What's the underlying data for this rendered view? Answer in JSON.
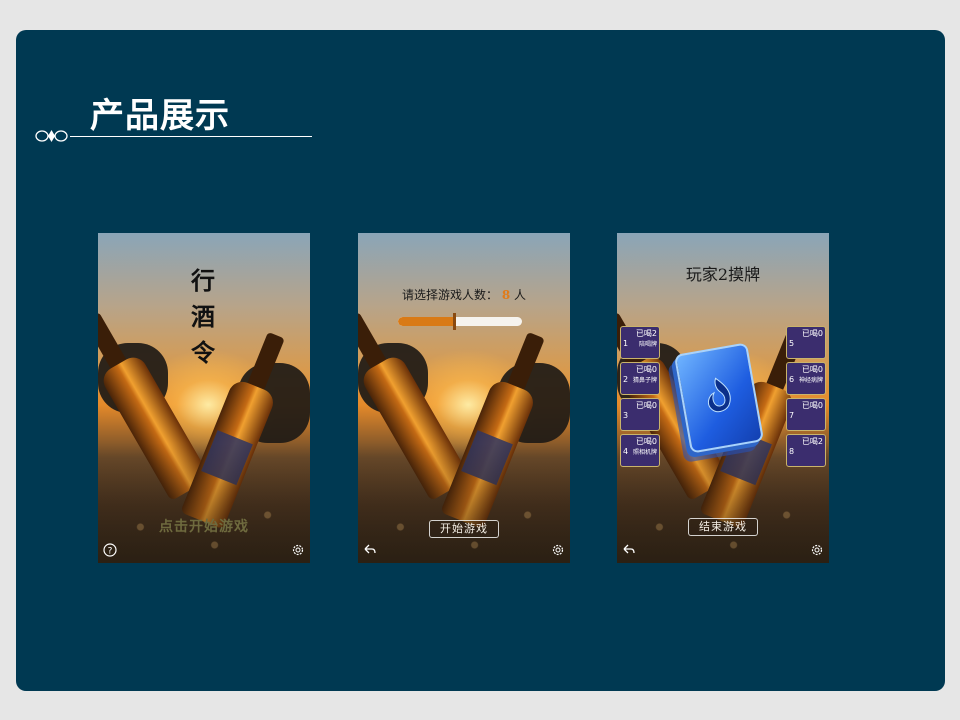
{
  "slide": {
    "title": "产品展示",
    "colors": {
      "background": "#003952",
      "accent": "#e07b1a",
      "text": "#ffffff"
    }
  },
  "screen1": {
    "title_chars": [
      "行",
      "酒",
      "令"
    ],
    "start_hint": "点击开始游戏",
    "icons": [
      "help-icon",
      "gear-icon"
    ]
  },
  "screen2": {
    "prompt_label": "请选择游戏人数：",
    "player_count": "8",
    "prompt_unit": "人",
    "slider_fraction": 0.45,
    "start_button": "开始游戏",
    "icons": [
      "back-icon",
      "gear-icon"
    ]
  },
  "screen3": {
    "title": "玩家2摸牌",
    "end_button": "结束游戏",
    "left_slots": [
      {
        "num": "1",
        "count": "已喝2",
        "card": "陪喝牌"
      },
      {
        "num": "2",
        "count": "已喝0",
        "card": "猜鼻子牌"
      },
      {
        "num": "3",
        "count": "已喝0",
        "card": ""
      },
      {
        "num": "4",
        "count": "已喝0",
        "card": "照相机牌"
      }
    ],
    "right_slots": [
      {
        "num": "5",
        "count": "已喝0",
        "card": ""
      },
      {
        "num": "6",
        "count": "已喝0",
        "card": "神经病牌"
      },
      {
        "num": "7",
        "count": "已喝0",
        "card": ""
      },
      {
        "num": "8",
        "count": "已喝2",
        "card": ""
      }
    ],
    "icons": [
      "back-icon",
      "gear-icon"
    ]
  }
}
